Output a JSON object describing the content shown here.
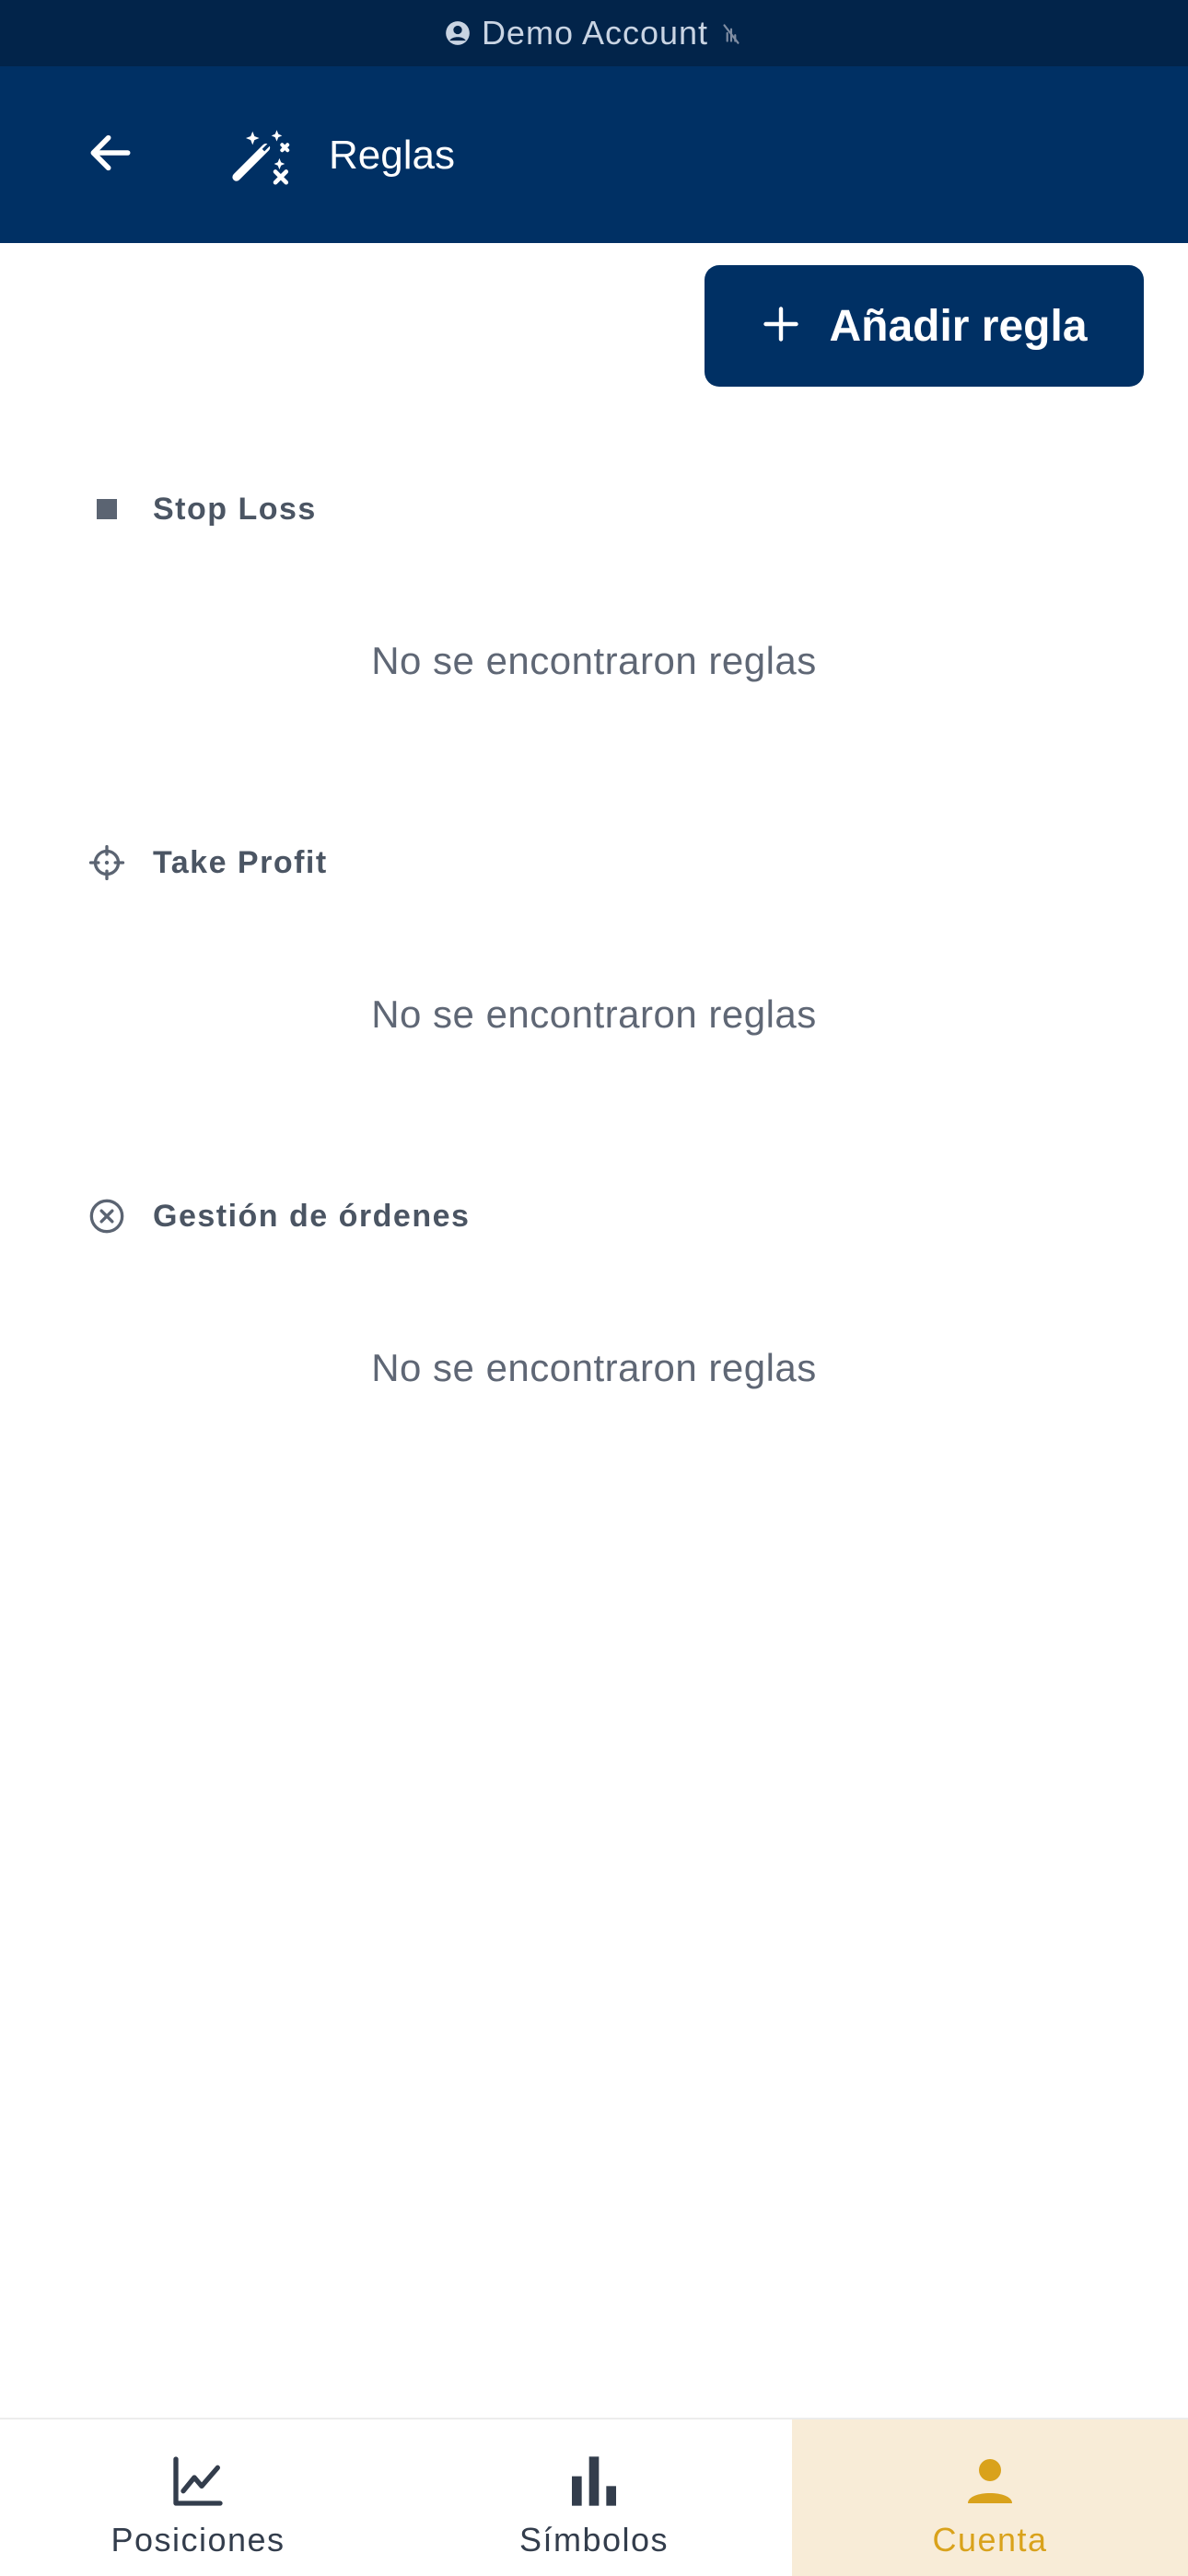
{
  "status_bar": {
    "account_label": "Demo Account",
    "icons": [
      "account-circle-icon",
      "signal-off-icon"
    ]
  },
  "app_bar": {
    "title": "Reglas",
    "back_icon": "arrow-left-icon",
    "title_icon": "magic-wand-icon"
  },
  "actions": {
    "add_rule_label": "Añadir regla",
    "add_rule_icon": "plus-icon"
  },
  "sections": [
    {
      "title": "Stop Loss",
      "icon": "stop-square-icon",
      "empty_text": "No se encontraron reglas"
    },
    {
      "title": "Take Profit",
      "icon": "crosshair-icon",
      "empty_text": "No se encontraron reglas"
    },
    {
      "title": "Gestión de órdenes",
      "icon": "cancel-circle-icon",
      "empty_text": "No se encontraron reglas"
    }
  ],
  "bottom_nav": {
    "items": [
      {
        "label": "Posiciones",
        "icon": "line-chart-icon",
        "active": false
      },
      {
        "label": "Símbolos",
        "icon": "bar-chart-icon",
        "active": false
      },
      {
        "label": "Cuenta",
        "icon": "person-icon",
        "active": true
      }
    ]
  },
  "colors": {
    "status_bar_bg": "#02244a",
    "primary": "#003064",
    "accent": "#d9a21b",
    "active_tab_bg": "#f8ecd7",
    "muted_text": "#5f6775"
  }
}
